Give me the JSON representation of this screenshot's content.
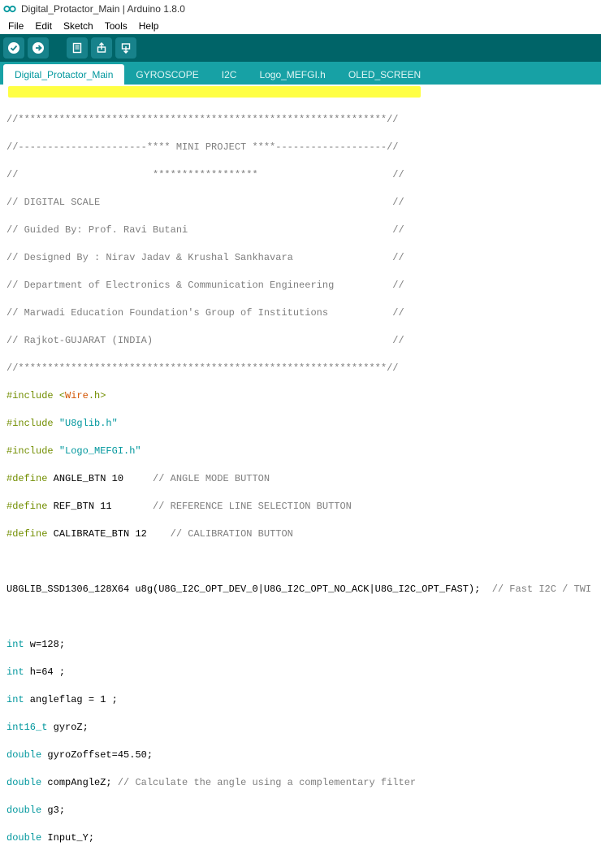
{
  "window": {
    "title": "Digital_Protactor_Main | Arduino 1.8.0"
  },
  "menu": {
    "file": "File",
    "edit": "Edit",
    "sketch": "Sketch",
    "tools": "Tools",
    "help": "Help"
  },
  "tabs": [
    {
      "label": "Digital_Protactor_Main",
      "active": true
    },
    {
      "label": "GYROSCOPE",
      "active": false
    },
    {
      "label": "I2C",
      "active": false
    },
    {
      "label": "Logo_MEFGI.h",
      "active": false
    },
    {
      "label": "OLED_SCREEN",
      "active": false
    }
  ],
  "code": {
    "l1": "//***************************************************************//",
    "l2a": "//----------------------**** MINI PROJECT ****-------------------//",
    "l3": "//                       ******************                       //",
    "l4": "// DIGITAL SCALE                                                  //",
    "l5": "// Guided By: Prof. Ravi Butani                                   //",
    "l6": "// Designed By : Nirav Jadav & Krushal Sankhavara                 //",
    "l7": "// Department of Electronics & Communication Engineering          //",
    "l8": "// Marwadi Education Foundation's Group of Institutions           //",
    "l9": "// Rajkot-GUJARAT (INDIA)                                         //",
    "l10": "//***************************************************************//",
    "inc": "#include",
    "lt": "<",
    "gt": ">",
    "wireA": "Wire",
    "wireB": ".h",
    "u8g": "\"U8glib.h\"",
    "logo": "\"Logo_MEFGI.h\"",
    "def": "#define",
    "d1": " ANGLE_BTN 10     ",
    "c1": "// ANGLE MODE BUTTON",
    "d2": " REF_BTN 11       ",
    "c2": "// REFERENCE LINE SELECTION BUTTON",
    "d3": " CALIBRATE_BTN 12    ",
    "c3": "// CALIBRATION BUTTON",
    "u8line": "U8GLIB_SSD1306_128X64 u8g(U8G_I2C_OPT_DEV_0|U8G_I2C_OPT_NO_ACK|U8G_I2C_OPT_FAST);  ",
    "u8c": "// Fast I2C / TWI",
    "t_int": "int",
    "t_i16": "int16_t",
    "t_dbl": "double",
    "v1": " w=128;",
    "v2": " h=64 ;",
    "v3": " angleflag = 1 ;",
    "v4": " gyroZ;",
    "v5": " gyroZoffset=45.50;",
    "v6": " compAngleZ; ",
    "c6": "// Calculate the angle using a complementary filter",
    "v7": " g3;",
    "v8": " Input_Y;"
  }
}
